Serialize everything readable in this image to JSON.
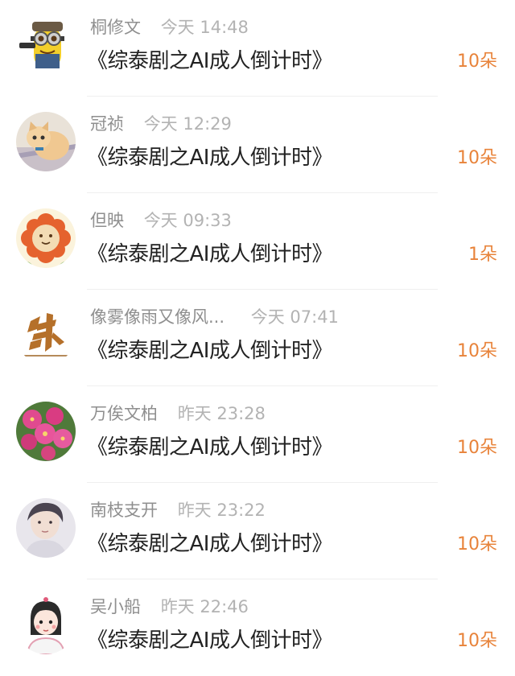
{
  "colors": {
    "name_text": "#8f8f8f",
    "time_text": "#b3b3b3",
    "title_text": "#222222",
    "gift_text": "#e8833a",
    "divider": "#efefef"
  },
  "items": [
    {
      "name": "桐修文",
      "time": "今天 14:48",
      "title": "《综泰剧之AI成人倒计时》",
      "gift": "10朵",
      "avatar_icon": "minion-avatar-icon"
    },
    {
      "name": "冠祯",
      "time": "今天 12:29",
      "title": "《综泰剧之AI成人倒计时》",
      "gift": "10朵",
      "avatar_icon": "kitten-avatar-icon"
    },
    {
      "name": "但映",
      "time": "今天 09:33",
      "title": "《综泰剧之AI成人倒计时》",
      "gift": "1朵",
      "avatar_icon": "flower-bear-avatar-icon"
    },
    {
      "name": "像雾像雨又像风...",
      "time": "今天 07:41",
      "title": "《综泰剧之AI成人倒计时》",
      "gift": "10朵",
      "avatar_icon": "calligraphy-avatar-icon"
    },
    {
      "name": "万俟文柏",
      "time": "昨天 23:28",
      "title": "《综泰剧之AI成人倒计时》",
      "gift": "10朵",
      "avatar_icon": "pink-flowers-avatar-icon"
    },
    {
      "name": "南枝支开",
      "time": "昨天 23:22",
      "title": "《综泰剧之AI成人倒计时》",
      "gift": "10朵",
      "avatar_icon": "portrait-avatar-icon"
    },
    {
      "name": "吴小船",
      "time": "昨天 22:46",
      "title": "《综泰剧之AI成人倒计时》",
      "gift": "10朵",
      "avatar_icon": "cartoon-girl-avatar-icon"
    }
  ]
}
